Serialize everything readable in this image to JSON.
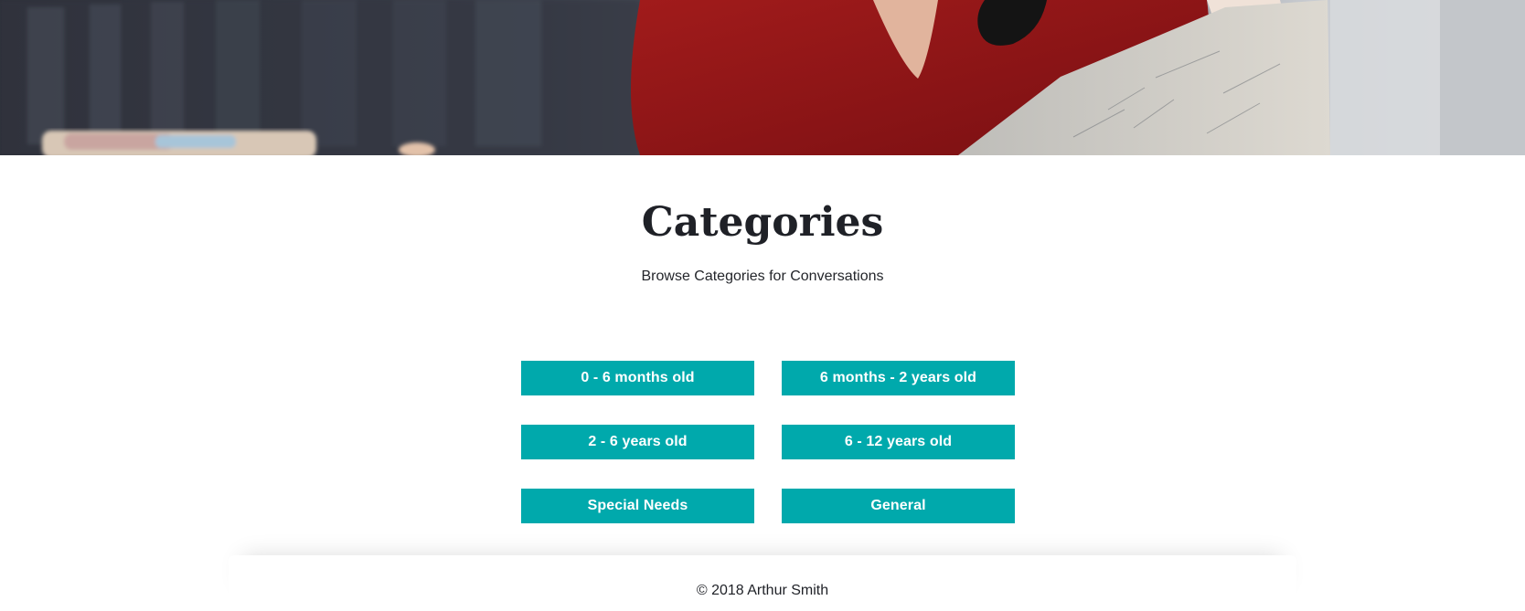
{
  "hero": {
    "image": "blurred-office-photo"
  },
  "header": {
    "title": "Categories",
    "subtitle": "Browse Categories for Conversations"
  },
  "categories": [
    {
      "label": "0 - 6 months old"
    },
    {
      "label": "6 months - 2 years old"
    },
    {
      "label": "2 - 6 years old"
    },
    {
      "label": "6 - 12 years old"
    },
    {
      "label": "Special Needs"
    },
    {
      "label": "General"
    }
  ],
  "footer": {
    "copyright": "© 2018 Arthur Smith"
  },
  "colors": {
    "button_bg": "#00a9ac",
    "button_text": "#ffffff",
    "title_text": "#1f2127"
  }
}
